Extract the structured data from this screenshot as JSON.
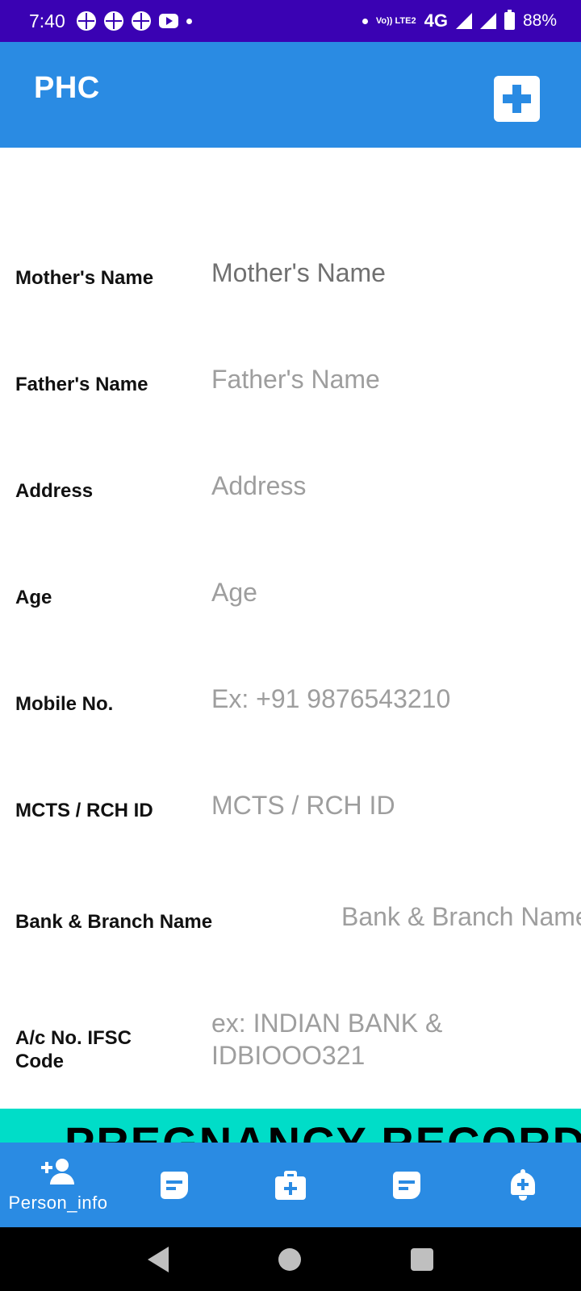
{
  "status_bar": {
    "time": "7:40",
    "network": "4G",
    "volte": "Vo)) LTE2",
    "battery": "88%"
  },
  "app_bar": {
    "title": "PHC",
    "add_icon": "medical-plus-icon"
  },
  "form": {
    "fields": [
      {
        "label": "Mother's Name",
        "placeholder": "Mother's Name",
        "value": ""
      },
      {
        "label": "Father's Name",
        "placeholder": "Father's Name",
        "value": ""
      },
      {
        "label": "Address",
        "placeholder": "Address",
        "value": ""
      },
      {
        "label": "Age",
        "placeholder": "Age",
        "value": ""
      },
      {
        "label": "Mobile No.",
        "placeholder": "Ex: +91 9876543210",
        "value": ""
      },
      {
        "label": "MCTS / RCH ID",
        "placeholder": "MCTS / RCH ID",
        "value": ""
      },
      {
        "label": "Bank & Branch Name",
        "placeholder": "Bank & Branch Name",
        "value": ""
      },
      {
        "label": "A/c No. IFSC Code",
        "placeholder": "ex: INDIAN BANK & IDBIOOO321",
        "value": ""
      }
    ]
  },
  "banner": {
    "text": "PREGNANCY RECORD"
  },
  "bottom_nav": {
    "items": [
      {
        "label": "Person_info",
        "icon": "person-add-icon"
      },
      {
        "label": "",
        "icon": "note-icon"
      },
      {
        "label": "",
        "icon": "medkit-icon"
      },
      {
        "label": "",
        "icon": "note-icon"
      },
      {
        "label": "",
        "icon": "bell-add-icon"
      }
    ]
  },
  "colors": {
    "status_bar": "#3a02b3",
    "primary": "#2a8be3",
    "banner": "#00ddc8"
  }
}
